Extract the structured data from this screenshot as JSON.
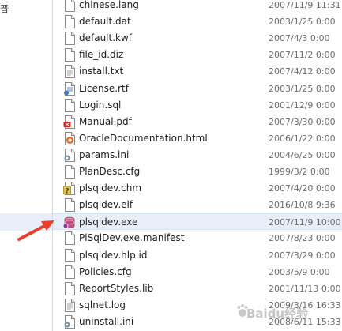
{
  "nav": {
    "fragment": "晋"
  },
  "files": [
    {
      "name": "chinese.lang",
      "date": "2007/11/9 11:31",
      "icon": "blank-file-icon"
    },
    {
      "name": "default.dat",
      "date": "2003/1/25 0:00",
      "icon": "blank-file-icon"
    },
    {
      "name": "default.kwf",
      "date": "2007/4/3 0:00",
      "icon": "blank-file-icon"
    },
    {
      "name": "file_id.diz",
      "date": "2007/11/2 0:00",
      "icon": "blank-file-icon"
    },
    {
      "name": "install.txt",
      "date": "2007/4/12 0:00",
      "icon": "text-file-icon"
    },
    {
      "name": "License.rtf",
      "date": "2003/1/25 0:00",
      "icon": "rtf-file-icon"
    },
    {
      "name": "Login.sql",
      "date": "2001/12/9 0:00",
      "icon": "blank-file-icon"
    },
    {
      "name": "Manual.pdf",
      "date": "2007/3/30 0:00",
      "icon": "pdf-file-icon"
    },
    {
      "name": "OracleDocumentation.html",
      "date": "2006/1/22 0:00",
      "icon": "html-file-icon"
    },
    {
      "name": "params.ini",
      "date": "2004/6/25 0:00",
      "icon": "settings-file-icon"
    },
    {
      "name": "PlanDesc.cfg",
      "date": "1999/3/2 0:00",
      "icon": "blank-file-icon"
    },
    {
      "name": "plsqldev.chm",
      "date": "2007/4/20 0:00",
      "icon": "help-file-icon"
    },
    {
      "name": "plsqldev.elf",
      "date": "2016/10/8 9:36",
      "icon": "blank-file-icon"
    },
    {
      "name": "plsqldev.exe",
      "date": "2007/11/9 10:00",
      "icon": "exe-file-icon",
      "selected": true
    },
    {
      "name": "PlSqlDev.exe.manifest",
      "date": "2007/8/23 0:00",
      "icon": "blank-file-icon"
    },
    {
      "name": "plsqldev.hlp.id",
      "date": "2007/3/29 0:00",
      "icon": "blank-file-icon"
    },
    {
      "name": "Policies.cfg",
      "date": "2003/5/9 0:00",
      "icon": "blank-file-icon"
    },
    {
      "name": "ReportStyles.lib",
      "date": "2001/11/13 0:00",
      "icon": "blank-file-icon"
    },
    {
      "name": "sqlnet.log",
      "date": "2009/3/16 16:33",
      "icon": "text-file-icon"
    },
    {
      "name": "uninstall.ini",
      "date": "2008/6/11 15:33",
      "icon": "settings-file-icon"
    }
  ],
  "watermark": {
    "text": "Baidu经验"
  },
  "colors": {
    "selection": "#e7eef8",
    "annotation_arrow": "#e8402c",
    "date_text": "#6d6d6d"
  }
}
